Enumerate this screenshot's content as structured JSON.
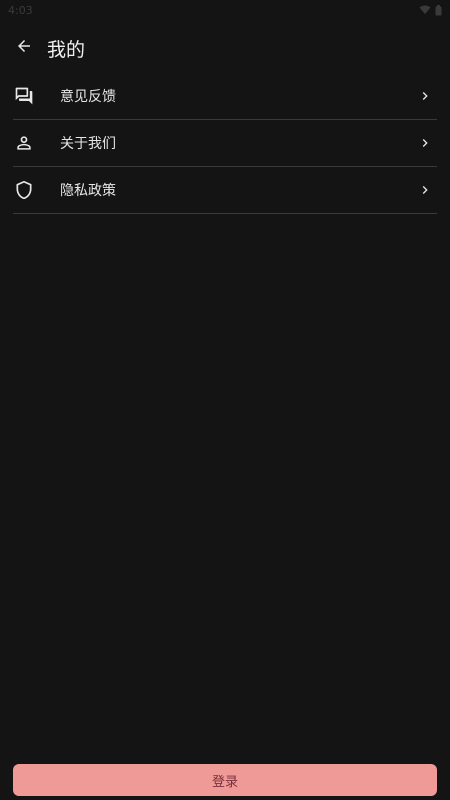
{
  "status_bar": {
    "time": "4:03",
    "icons": [
      "wifi-icon",
      "battery-icon"
    ]
  },
  "app_bar": {
    "back_icon": "arrow-back-icon",
    "title": "我的"
  },
  "menu": {
    "items": [
      {
        "label": "意见反馈",
        "icon": "feedback-icon"
      },
      {
        "label": "关于我们",
        "icon": "person-icon"
      },
      {
        "label": "隐私政策",
        "icon": "shield-icon"
      }
    ],
    "chevron_icon": "chevron-right-icon"
  },
  "login": {
    "label": "登录",
    "color": "#ef9a96"
  },
  "colors": {
    "background": "#141414",
    "divider": "#3a3a3a",
    "text": "#e6e6e6"
  }
}
